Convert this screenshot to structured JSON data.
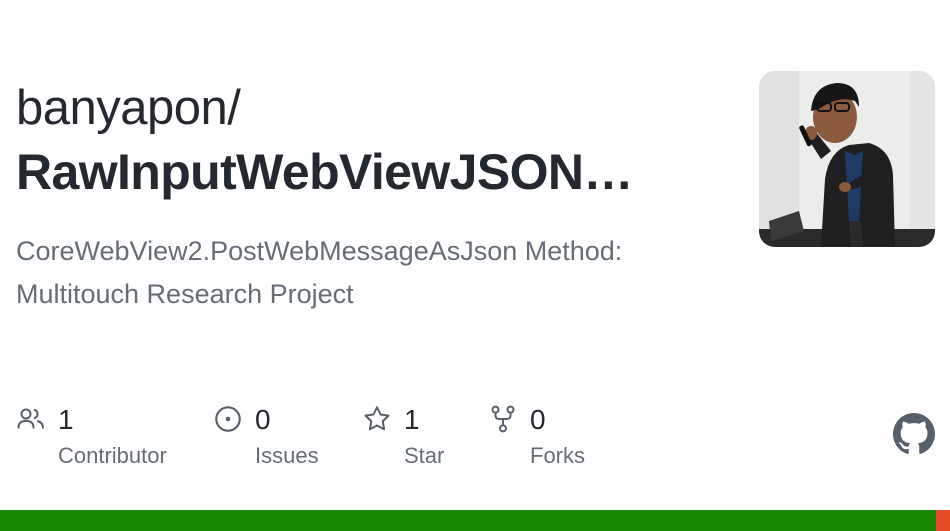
{
  "repo": {
    "owner": "banyapon/",
    "name": "RawInputWebViewJSON…",
    "description": "CoreWebView2.PostWebMessageAsJson Method: Multitouch Research Project"
  },
  "stats": [
    {
      "icon": "people-icon",
      "count": "1",
      "label": "Contributor"
    },
    {
      "icon": "issue-circle-icon",
      "count": "0",
      "label": "Issues"
    },
    {
      "icon": "star-icon",
      "count": "1",
      "label": "Star"
    },
    {
      "icon": "fork-icon",
      "count": "0",
      "label": "Forks"
    }
  ],
  "languages": [
    {
      "color": "#178600",
      "share": 0.985
    },
    {
      "color": "#e34c26",
      "share": 0.015
    }
  ],
  "colors": {
    "title": "#24292f",
    "muted": "#656d76",
    "logo": "#57606a"
  }
}
